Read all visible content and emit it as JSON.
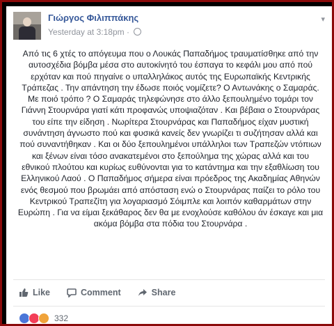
{
  "post": {
    "author": "Γιώργος Φιλιππάκης",
    "timestamp": "Yesterday at 3:18pm",
    "separator": "·",
    "text": "Από τις 6 χτές το απόγευμα που ο Λουκάς Παπαδήμος τραυματίσθηκε από την αυτοσχέδια βόμβα μέσα στο αυτοκίνητό του έσπαγα το κεφάλι μου από πού ερχόταν και πού πηγαίνε ο υπαλληλάκος αυτός της Ευρωπαϊκής Κεντρικής Τράπεζας . Την απάντηση την έδωσε ποιός νομίζετε? Ο Αντωνάκης ο Σαμαράς. Με ποιό τρόπο ? Ο Σαμαράς τηλεφώνησε στο άλλο ξεπουλημένο τομάρι τον Γιάννη Στουρνάρα γιατί κάτι προφανώς υποψιαζόταν . Και βέβαια ο Στουρνάρας του είπε την είδηση . Νωρίτερα Στουρνάρας και Παπαδήμος είχαν μυστική συνάντηση άγνωστο πού και φυσικά κανείς δεν γνωρίζει τι συζήτησαν αλλά και πού συναντήθηκαν . Και οι δύο ξεπουλημένοι υπάλληλοι των Τραπεζών ντόπιων και ξένων είναι τόσο ανακατεμένοι στο ξεπούλημα της χώρας αλλά και του εθνικού πλούτου και κυρίως ευθύνονται για το κατάντημα και την εξαθλίωση του Ελληνικού Λαού . Ο Παπαδήμος σήμερα είναι πρόεδρος της Ακαδημίας Αθηνών ενός θεσμού που βρωμάει από απόσταση ενώ ο Στουρνάρας παίζει το ρόλο του Κεντρικού Τραπεζίτη για λογαριασμό Σόιμπλε και λοιπόν καθαρμάτων στην Ευρώπη . Για να είμαι ξεκάθαρος δεν θα με ενοχλούσε καθόλου άν έσκαγε και μια ακόμα βόμβα στα πόδια του Στουρνάρα ."
  },
  "actions": {
    "like": "Like",
    "comment": "Comment",
    "share": "Share"
  },
  "reactions": {
    "count": "332",
    "types": [
      "like-icon",
      "love-icon",
      "angry-icon"
    ]
  },
  "colors": {
    "author_link": "#365899",
    "frame": "#8b0a0a",
    "like_blue": "#4a76d8"
  }
}
